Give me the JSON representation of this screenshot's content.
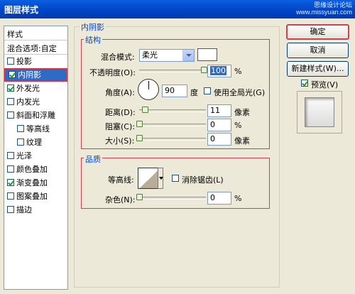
{
  "window": {
    "title": "图层样式",
    "watermark_line1": "思缘设计论坛",
    "watermark_line2": "www.missyuan.com"
  },
  "sidebar": {
    "header": "样式",
    "blend_options": "混合选项:自定",
    "items": [
      {
        "label": "投影",
        "checked": false,
        "sub": false
      },
      {
        "label": "内阴影",
        "checked": true,
        "sub": false,
        "selected": true
      },
      {
        "label": "外发光",
        "checked": true,
        "sub": false
      },
      {
        "label": "内发光",
        "checked": false,
        "sub": false
      },
      {
        "label": "斜面和浮雕",
        "checked": false,
        "sub": false
      },
      {
        "label": "等高线",
        "checked": false,
        "sub": true
      },
      {
        "label": "纹理",
        "checked": false,
        "sub": true
      },
      {
        "label": "光泽",
        "checked": false,
        "sub": false
      },
      {
        "label": "颜色叠加",
        "checked": false,
        "sub": false
      },
      {
        "label": "渐变叠加",
        "checked": true,
        "sub": false
      },
      {
        "label": "图案叠加",
        "checked": false,
        "sub": false
      },
      {
        "label": "描边",
        "checked": false,
        "sub": false
      }
    ]
  },
  "panel": {
    "title": "内阴影",
    "structure": {
      "legend": "结构",
      "blend_mode_label": "混合模式:",
      "blend_mode_value": "柔光",
      "shadow_color": "#ffffff",
      "opacity_label": "不透明度(O):",
      "opacity_value": "100",
      "opacity_unit": "%",
      "angle_label": "角度(A):",
      "angle_value": "90",
      "angle_unit": "度",
      "global_light_label": "使用全局光(G)",
      "distance_label": "距离(D):",
      "distance_value": "11",
      "distance_unit": "像素",
      "choke_label": "阻塞(C):",
      "choke_value": "0",
      "choke_unit": "%",
      "size_label": "大小(S):",
      "size_value": "0",
      "size_unit": "像素"
    },
    "quality": {
      "legend": "品质",
      "contour_label": "等高线:",
      "antialias_label": "消除锯齿(L)",
      "noise_label": "杂色(N):",
      "noise_value": "0",
      "noise_unit": "%"
    }
  },
  "buttons": {
    "ok": "确定",
    "cancel": "取消",
    "new_style": "新建样式(W)...",
    "preview_label": "预览(V)"
  }
}
